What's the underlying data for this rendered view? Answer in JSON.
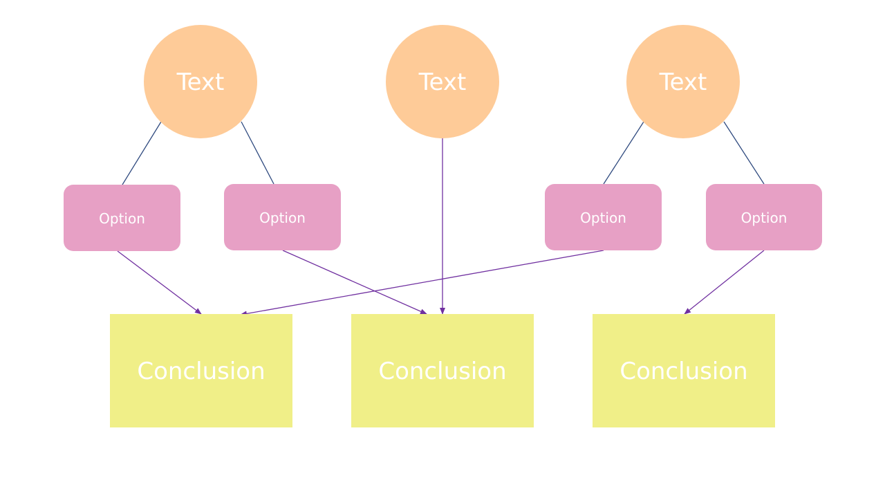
{
  "colors": {
    "circle_fill": "#FECB98",
    "option_fill": "#E7A0C5",
    "conclusion_fill": "#F0EF88",
    "node_text": "#FFFFFF",
    "line_color": "#2F4A7F",
    "arrow_color": "#7030A0",
    "background": "#FFFFFF"
  },
  "nodes": {
    "topics": [
      {
        "id": "c1",
        "label": "Text"
      },
      {
        "id": "c2",
        "label": "Text"
      },
      {
        "id": "c3",
        "label": "Text"
      }
    ],
    "options": [
      {
        "id": "o1",
        "label": "Option"
      },
      {
        "id": "o2",
        "label": "Option"
      },
      {
        "id": "o3",
        "label": "Option"
      },
      {
        "id": "o4",
        "label": "Option"
      }
    ],
    "conclusions": [
      {
        "id": "k1",
        "label": "Conclusion"
      },
      {
        "id": "k2",
        "label": "Conclusion"
      },
      {
        "id": "k3",
        "label": "Conclusion"
      }
    ]
  },
  "edges": [
    {
      "from": "c1",
      "to": "o1",
      "type": "line"
    },
    {
      "from": "c1",
      "to": "o2",
      "type": "line"
    },
    {
      "from": "c3",
      "to": "o3",
      "type": "line"
    },
    {
      "from": "c3",
      "to": "o4",
      "type": "line"
    },
    {
      "from": "o1",
      "to": "k1",
      "type": "arrow"
    },
    {
      "from": "o2",
      "to": "k2",
      "type": "arrow"
    },
    {
      "from": "c2",
      "to": "k2",
      "type": "arrow"
    },
    {
      "from": "o3",
      "to": "k1",
      "type": "arrow"
    },
    {
      "from": "o4",
      "to": "k3",
      "type": "arrow"
    }
  ]
}
